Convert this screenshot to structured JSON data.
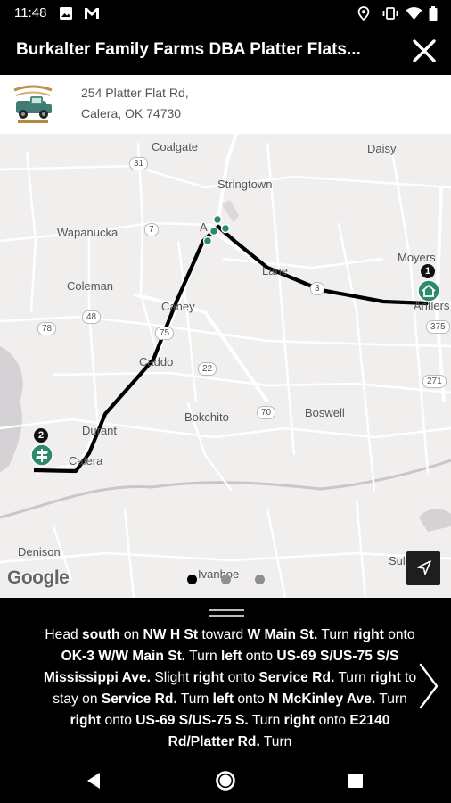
{
  "status_bar": {
    "time": "11:48",
    "icons": [
      "image-icon",
      "gmail-icon",
      "location-icon",
      "vibrate-icon",
      "wifi-icon",
      "battery-icon"
    ]
  },
  "header": {
    "title": "Burkalter Family Farms DBA Platter Flats...",
    "close_icon": "close-icon"
  },
  "address": {
    "line1": "254 Platter Flat Rd,",
    "line2": "Calera, OK 74730"
  },
  "map": {
    "places": {
      "coalgate": "Coalgate",
      "daisy": "Daisy",
      "stringtown": "Stringtown",
      "wapanucka": "Wapanucka",
      "atoka": "A",
      "moyers": "Moyers",
      "lane": "Lane",
      "antlers": "Antlers",
      "coleman": "Coleman",
      "caney": "Caney",
      "caddo": "Caddo",
      "bokchito": "Bokchito",
      "boswell": "Boswell",
      "durant": "Durant",
      "calera": "Calera",
      "denison": "Denison",
      "ivanhoe": "Ivanhoe",
      "sulphur": "Sul"
    },
    "shields": {
      "r31": "31",
      "r7": "7",
      "r3": "3",
      "r48": "48",
      "r75": "75",
      "r78": "78",
      "r22": "22",
      "r70": "70",
      "r375": "375",
      "r271": "271"
    },
    "markers": [
      {
        "label": "1"
      },
      {
        "label": "2"
      }
    ],
    "attribution": "Google",
    "page_indicator": {
      "count": 3,
      "active": 1
    },
    "colors": {
      "route": "#000000",
      "marker": "#2e8b6a",
      "water": "#d6d4d6",
      "roads": "#ffffff"
    }
  },
  "directions": {
    "parts": [
      {
        "t": "Head ",
        "b": false
      },
      {
        "t": "south",
        "b": true
      },
      {
        "t": " on ",
        "b": false
      },
      {
        "t": "NW H St",
        "b": true
      },
      {
        "t": " toward ",
        "b": false
      },
      {
        "t": "W Main St.",
        "b": true
      },
      {
        "t": " Turn ",
        "b": false
      },
      {
        "t": "right",
        "b": true
      },
      {
        "t": " onto ",
        "b": false
      },
      {
        "t": "OK-3 W/W Main St.",
        "b": true
      },
      {
        "t": " Turn ",
        "b": false
      },
      {
        "t": "left",
        "b": true
      },
      {
        "t": " onto ",
        "b": false
      },
      {
        "t": "US-69 S/US-75 S/S Mississippi Ave.",
        "b": true
      },
      {
        "t": " Slight ",
        "b": false
      },
      {
        "t": "right",
        "b": true
      },
      {
        "t": " onto ",
        "b": false
      },
      {
        "t": "Service Rd.",
        "b": true
      },
      {
        "t": " Turn ",
        "b": false
      },
      {
        "t": "right",
        "b": true
      },
      {
        "t": " to stay on ",
        "b": false
      },
      {
        "t": "Service Rd.",
        "b": true
      },
      {
        "t": " Turn ",
        "b": false
      },
      {
        "t": "left",
        "b": true
      },
      {
        "t": " onto ",
        "b": false
      },
      {
        "t": "N McKinley Ave.",
        "b": true
      },
      {
        "t": " Turn ",
        "b": false
      },
      {
        "t": "right",
        "b": true
      },
      {
        "t": " onto ",
        "b": false
      },
      {
        "t": "US-69 S/US-75 S.",
        "b": true
      },
      {
        "t": " Turn ",
        "b": false
      },
      {
        "t": "right",
        "b": true
      },
      {
        "t": " onto ",
        "b": false
      },
      {
        "t": "E2140 Rd/Platter Rd.",
        "b": true
      },
      {
        "t": " Turn",
        "b": false
      }
    ]
  }
}
